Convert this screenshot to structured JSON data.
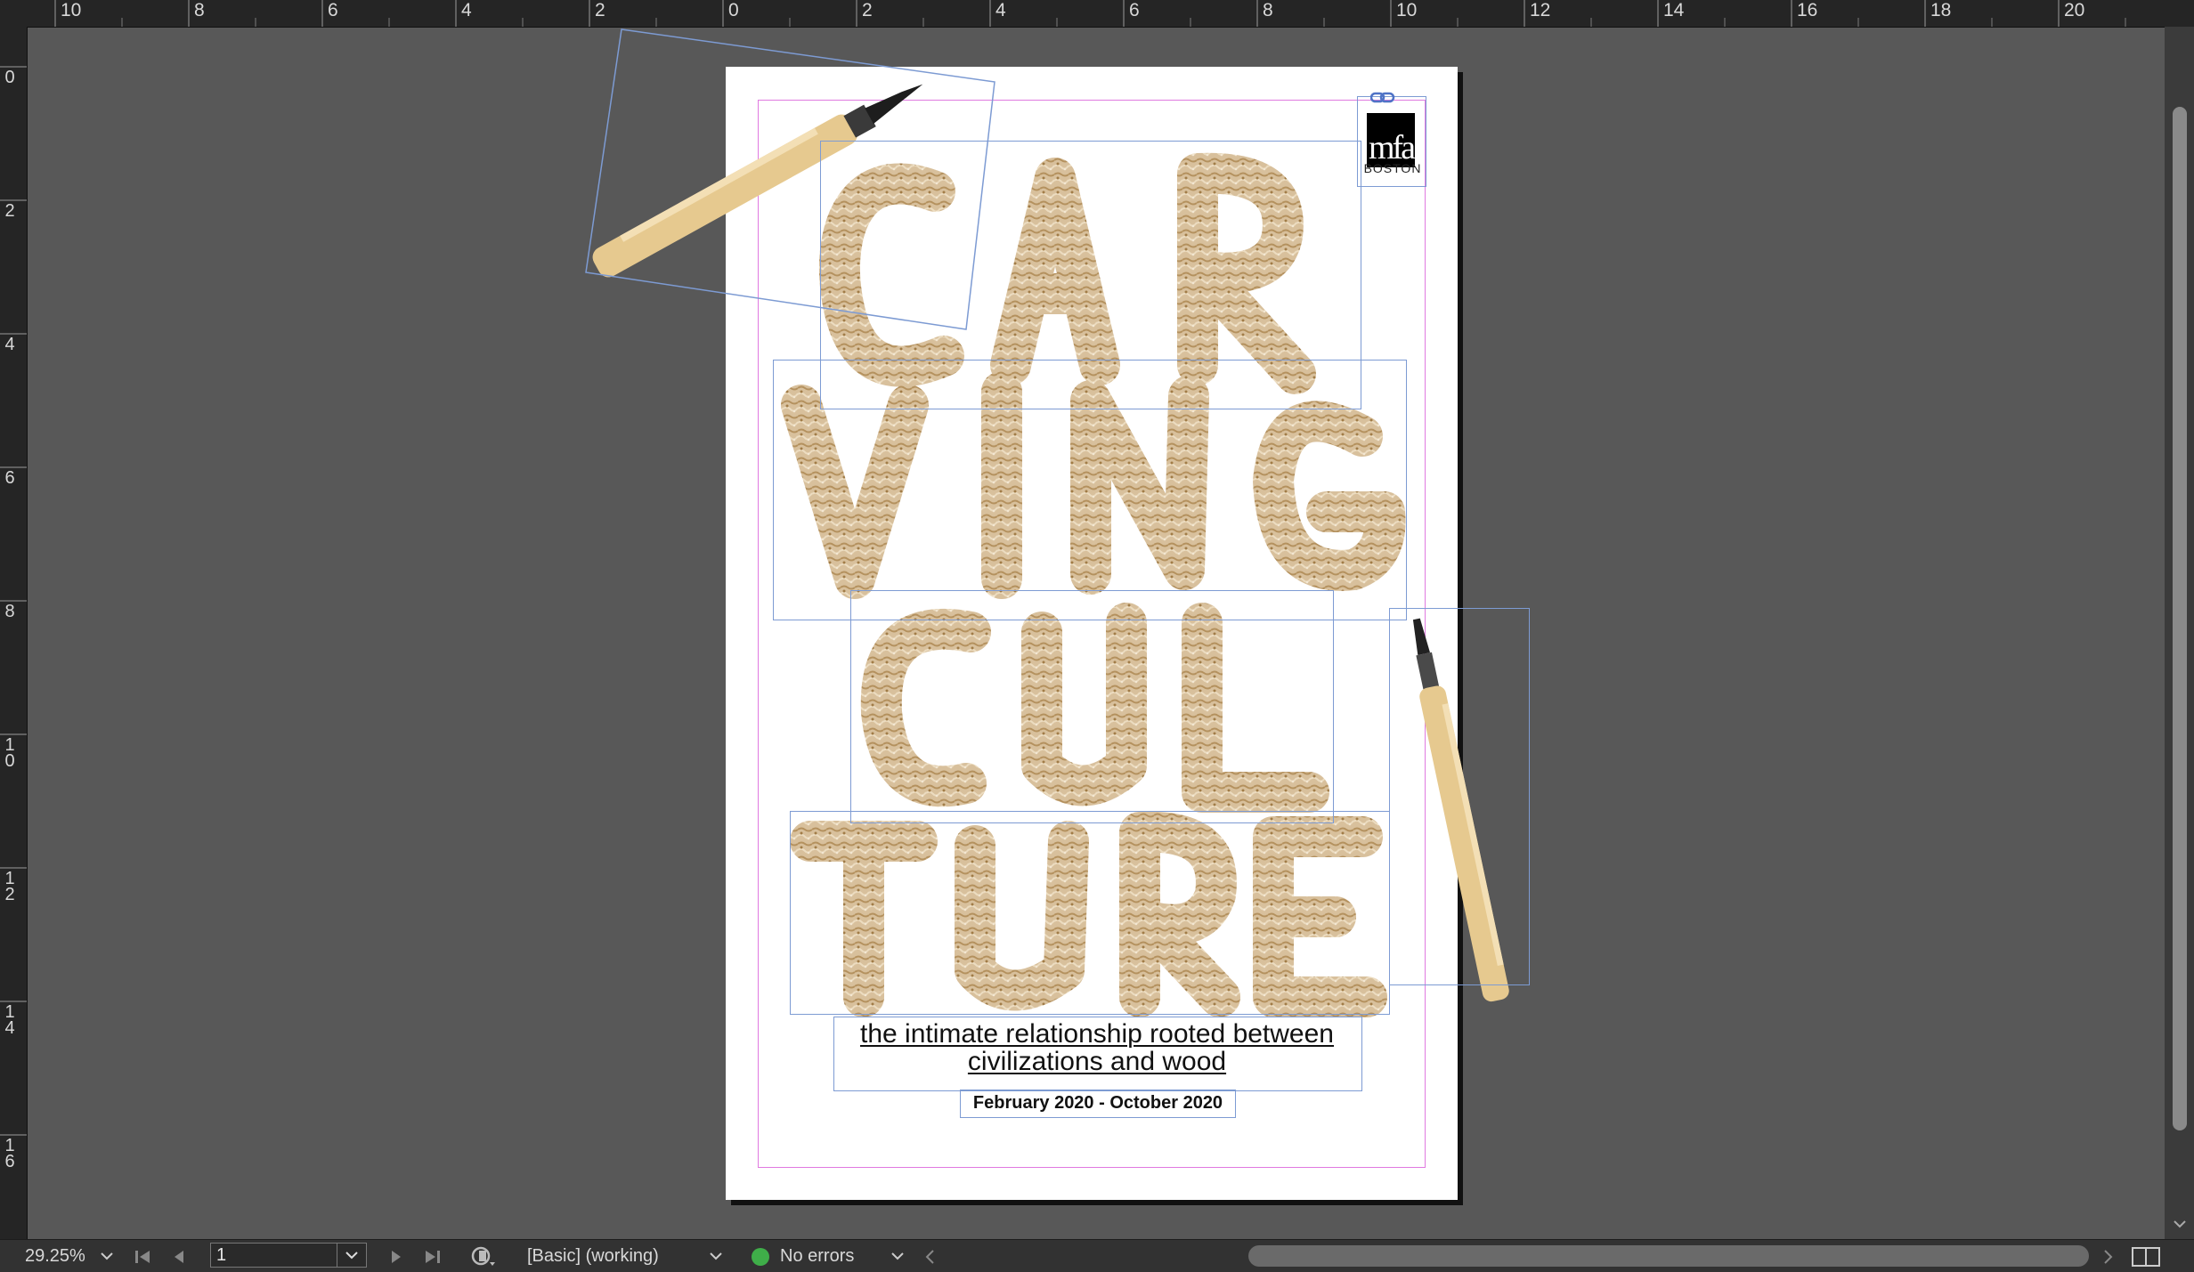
{
  "rulers": {
    "horizontal_labels": [
      "10",
      "8",
      "6",
      "4",
      "2",
      "0",
      "2",
      "4",
      "6",
      "8",
      "10",
      "12",
      "14",
      "16",
      "18",
      "20"
    ],
    "vertical_labels": [
      "0",
      "2",
      "4",
      "6",
      "8",
      "1\n0",
      "1\n2",
      "1\n4",
      "1\n6"
    ]
  },
  "document": {
    "headline_lines": [
      "CAR",
      "VING",
      "CUL",
      "TURE"
    ],
    "subtitle": "the intimate relationship rooted between civilizations and wood",
    "dates": "February 2020 - October 2020",
    "logo": {
      "mark": "mfa",
      "location": "BOSTON"
    }
  },
  "statusbar": {
    "zoom": "29.25%",
    "page_number": "1",
    "preflight_profile": "[Basic] (working)",
    "preflight_status": "No errors",
    "preflight_status_color": "#3fae49"
  },
  "colors": {
    "frame_edge": "#7d9bd3",
    "margin_guide": "#e07ae0",
    "pasteboard": "#585858"
  },
  "icons": [
    "first-page-icon",
    "previous-page-icon",
    "next-page-icon",
    "last-page-icon",
    "chevron-down-icon",
    "preflight-icon",
    "link-icon",
    "split-view-icon",
    "chisel-tool-image"
  ]
}
